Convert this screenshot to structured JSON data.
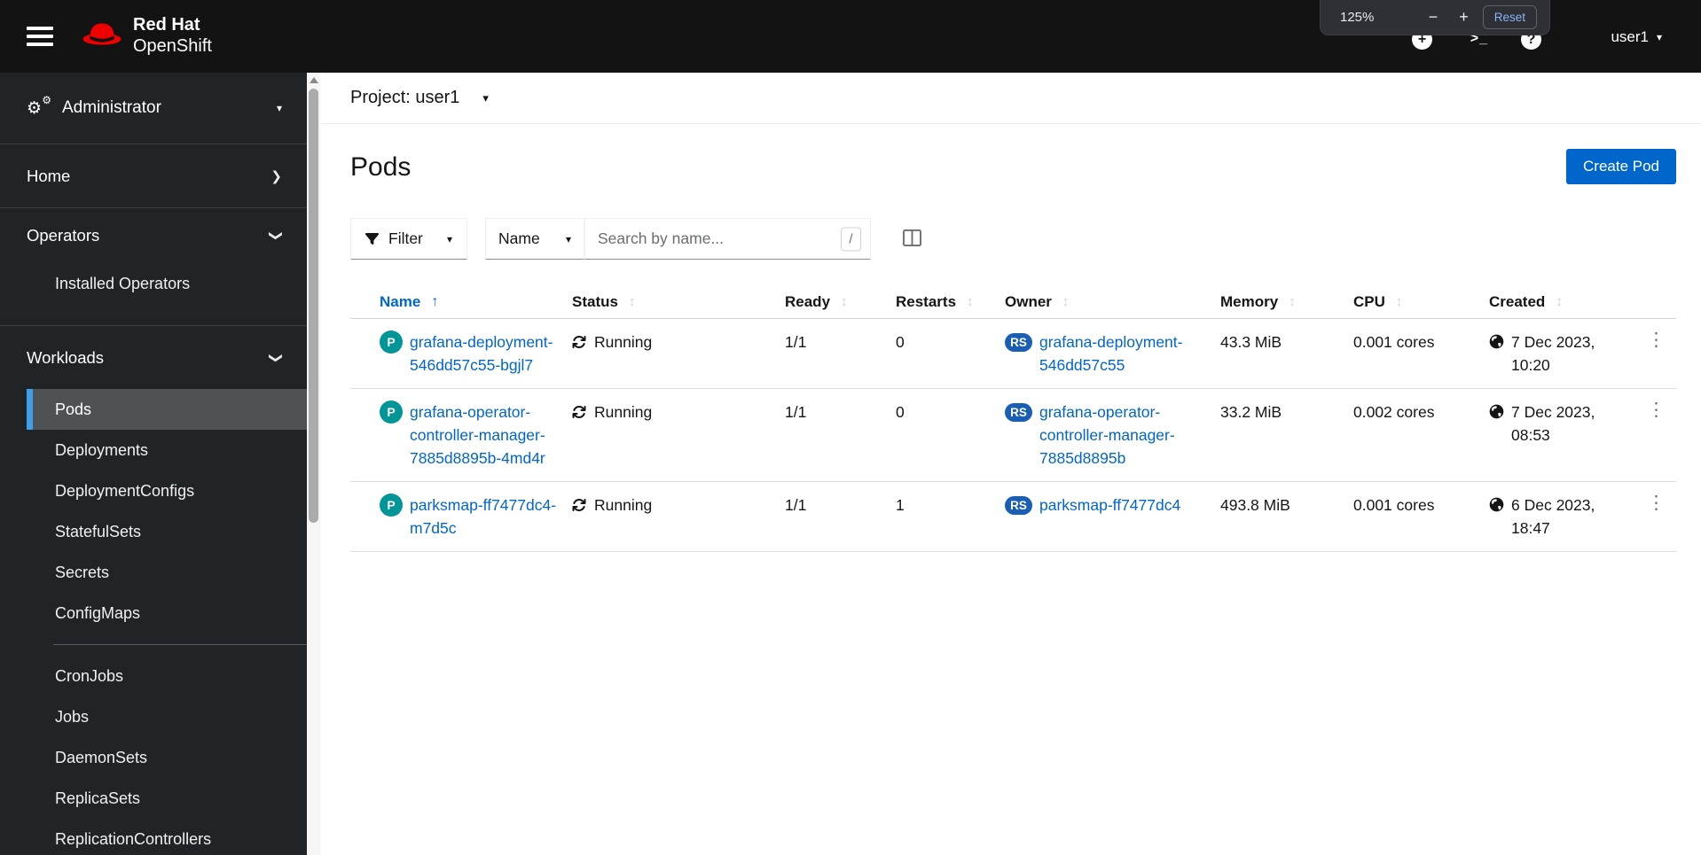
{
  "masthead": {
    "brand": {
      "line1": "Red Hat",
      "line2": "OpenShift"
    },
    "user": {
      "name": "user1"
    },
    "zoom_popup": {
      "level": "125%",
      "minus": "−",
      "plus": "+",
      "reset": "Reset"
    }
  },
  "icons": {
    "gear": "⚙",
    "chevron": "❯",
    "caret_down": "▾",
    "terminal": ">_",
    "plus": "+",
    "question": "?",
    "kebab": "⋮",
    "sort_active": "↑",
    "sort_idle": "↕"
  },
  "sidebar": {
    "perspective": {
      "label": "Administrator"
    },
    "home": {
      "label": "Home"
    },
    "operators": {
      "label": "Operators",
      "items": [
        {
          "label": "Installed Operators"
        }
      ]
    },
    "workloads": {
      "label": "Workloads",
      "items_top": [
        {
          "label": "Pods"
        },
        {
          "label": "Deployments"
        },
        {
          "label": "DeploymentConfigs"
        },
        {
          "label": "StatefulSets"
        },
        {
          "label": "Secrets"
        },
        {
          "label": "ConfigMaps"
        }
      ],
      "items_bottom": [
        {
          "label": "CronJobs"
        },
        {
          "label": "Jobs"
        },
        {
          "label": "DaemonSets"
        },
        {
          "label": "ReplicaSets"
        },
        {
          "label": "ReplicationControllers"
        }
      ]
    }
  },
  "main": {
    "project_bar": {
      "label": "Project: user1"
    },
    "page": {
      "title": "Pods",
      "create_button": "Create Pod"
    },
    "toolbar": {
      "filter_label": "Filter",
      "name_label": "Name",
      "search_placeholder": "Search by name...",
      "shortcut": "/"
    },
    "table": {
      "columns": [
        "Name",
        "Status",
        "Ready",
        "Restarts",
        "Owner",
        "Memory",
        "CPU",
        "Created"
      ],
      "rows": [
        {
          "badge": "P",
          "name": "grafana-deployment-546dd57c55-bgjl7",
          "status": "Running",
          "ready": "1/1",
          "restarts": "0",
          "owner_badge": "RS",
          "owner": "grafana-deployment-546dd57c55",
          "memory": "43.3 MiB",
          "cpu": "0.001 cores",
          "created": "7 Dec 2023, 10:20"
        },
        {
          "badge": "P",
          "name": "grafana-operator-controller-manager-7885d8895b-4md4r",
          "status": "Running",
          "ready": "1/1",
          "restarts": "0",
          "owner_badge": "RS",
          "owner": "grafana-operator-controller-manager-7885d8895b",
          "memory": "33.2 MiB",
          "cpu": "0.002 cores",
          "created": "7 Dec 2023, 08:53"
        },
        {
          "badge": "P",
          "name": "parksmap-ff7477dc4-m7d5c",
          "status": "Running",
          "ready": "1/1",
          "restarts": "1",
          "owner_badge": "RS",
          "owner": "parksmap-ff7477dc4",
          "memory": "493.8 MiB",
          "cpu": "0.001 cores",
          "created": "6 Dec 2023, 18:47"
        }
      ]
    }
  },
  "colors": {
    "primary": "#0066cc",
    "pod_badge": "#009596",
    "replicaset_badge": "#1a5fb4",
    "masthead_bg": "#131313",
    "nav_bg": "#212427"
  }
}
